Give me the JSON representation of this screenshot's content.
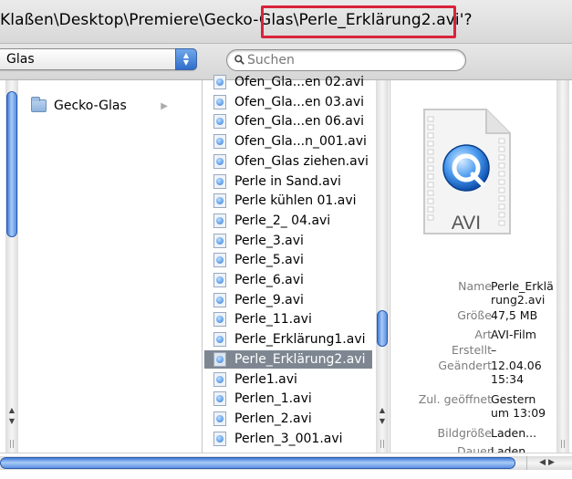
{
  "path_bar": {
    "path": "Klaßen\\Desktop\\Premiere\\Gecko-Glas\\Perle_Erklärung2.avi'?"
  },
  "toolbar": {
    "location_value": "Glas",
    "search_placeholder": "Suchen"
  },
  "column1": {
    "items": [
      {
        "label": "Gecko-Glas",
        "disclosure": "▶"
      }
    ]
  },
  "column2": {
    "items": [
      {
        "label": "Ofen_Gla...en 02.avi"
      },
      {
        "label": "Ofen_Gla...en 03.avi"
      },
      {
        "label": "Ofen_Gla...en 06.avi"
      },
      {
        "label": "Ofen_Gla...n_001.avi"
      },
      {
        "label": "Ofen_Glas ziehen.avi"
      },
      {
        "label": "Perle in Sand.avi"
      },
      {
        "label": "Perle kühlen 01.avi"
      },
      {
        "label": "Perle_2_ 04.avi"
      },
      {
        "label": "Perle_3.avi"
      },
      {
        "label": "Perle_5.avi"
      },
      {
        "label": "Perle_6.avi"
      },
      {
        "label": "Perle_9.avi"
      },
      {
        "label": "Perle_11.avi"
      },
      {
        "label": "Perle_Erklärung1.avi"
      },
      {
        "label": "Perle_Erklärung2.avi",
        "selected": true
      },
      {
        "label": "Perle1.avi"
      },
      {
        "label": "Perlen_1.avi"
      },
      {
        "label": "Perlen_2.avi"
      },
      {
        "label": "Perlen_3_001.avi"
      }
    ]
  },
  "preview": {
    "doc_label": "AVI",
    "info": [
      {
        "label": "Name",
        "value": "Perle_Erklä\nrung2.avi"
      },
      {
        "label": "Größe",
        "value": "47,5 MB"
      },
      {
        "label": "Art",
        "value": "AVI-Film"
      },
      {
        "label": "Erstellt",
        "value": "–"
      },
      {
        "label": "Geändert",
        "value": "12.04.06\n15:34"
      },
      {
        "label": "Zul. geöffnet",
        "value": "Gestern\num 13:09"
      },
      {
        "label": "Bildgröße",
        "value": "Laden..."
      },
      {
        "label": "Dauer",
        "value": "Laden..."
      }
    ]
  },
  "colors": {
    "highlight": "#d9233a",
    "selection": "#7e8791",
    "scroll_thumb": "#3f78d6"
  }
}
